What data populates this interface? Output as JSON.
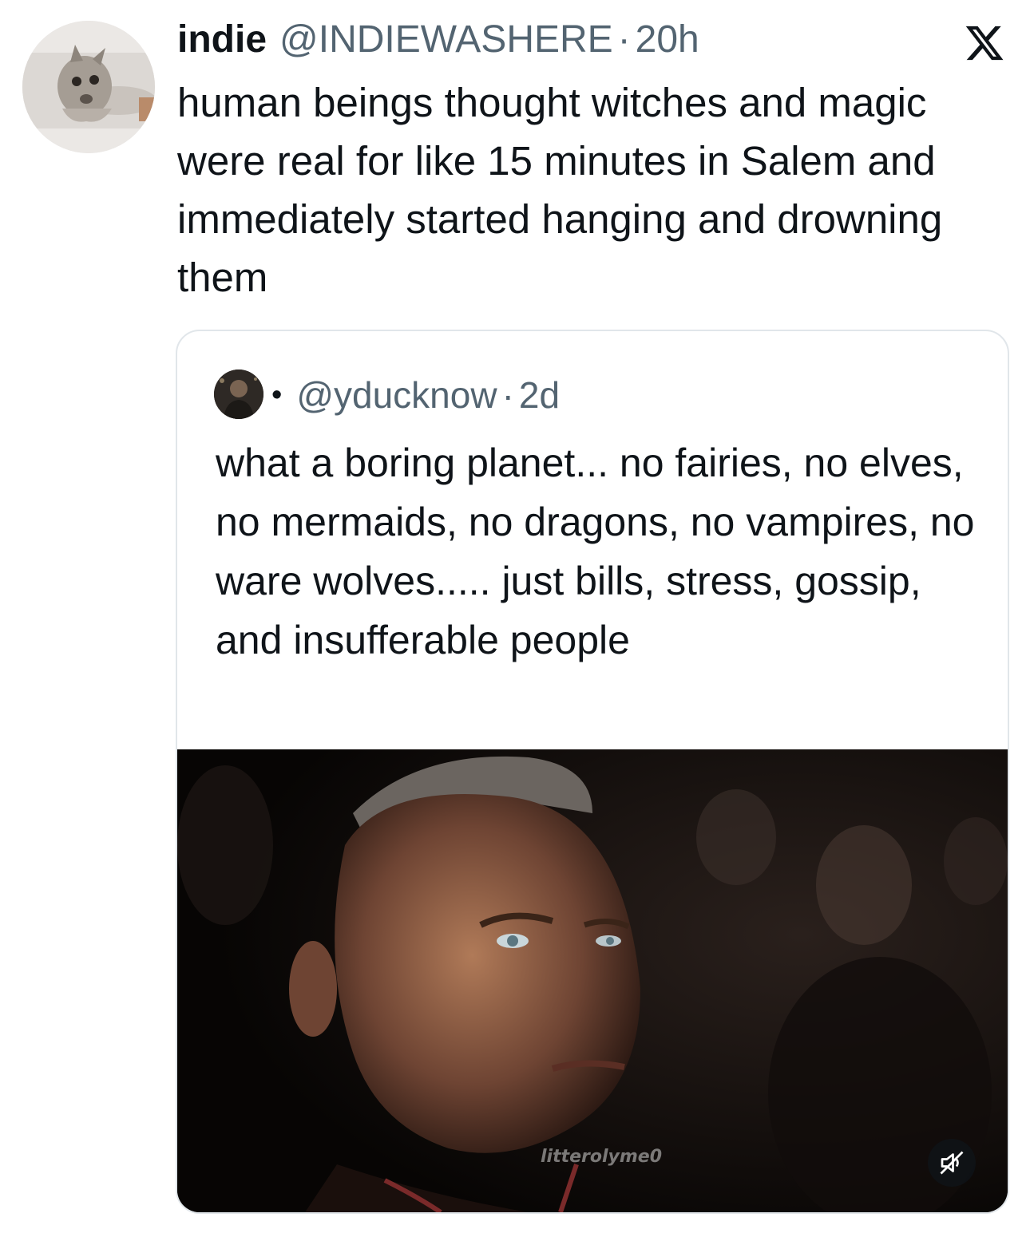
{
  "tweet": {
    "display_name": "indie",
    "handle": "@INDIEWASHERE",
    "separator": "·",
    "time": "20h",
    "avatar_icon": "cat-avatar",
    "text": "human beings thought witches and magic were real for like 15 minutes in Salem and immediately started hanging and drowning them"
  },
  "platform": {
    "logo_icon": "x-logo-icon"
  },
  "quoted": {
    "bullet": "•",
    "handle": "@yducknow",
    "separator": "·",
    "time": "2d",
    "text": "what a boring planet... no fairies, no elves, no mermaids, no dragons, no vampires, no ware wolves..... just bills, stress, gossip, and insufferable people",
    "media": {
      "description_icon": "video-thumbnail",
      "watermark": "litterolyme0",
      "mute_icon": "speaker-muted-icon"
    }
  },
  "colors": {
    "text_primary": "#0f1419",
    "text_secondary": "#536471",
    "border": "#e1e6ea"
  }
}
